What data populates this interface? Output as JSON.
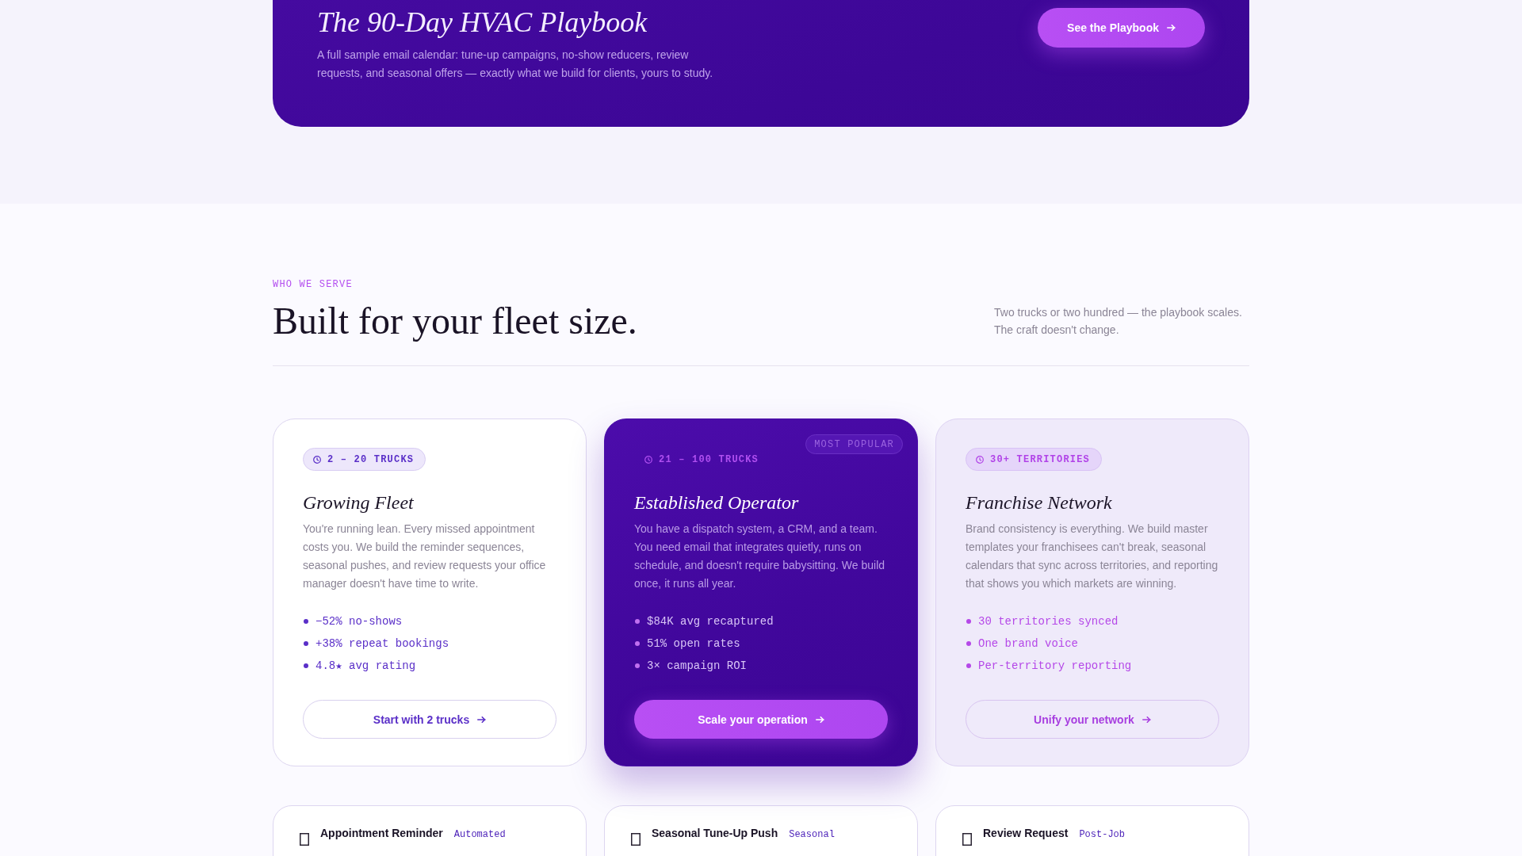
{
  "promo_banner": {
    "title": "The 90-Day HVAC Playbook",
    "description": "A full sample email calendar: tune-up campaigns, no-show reducers, review requests, and seasonal offers — exactly what we build for clients, yours to study.",
    "button": "See the Playbook"
  },
  "section": {
    "eyebrow": "WHO WE SERVE",
    "heading": "Built for your fleet size.",
    "aside": "Two trucks or two hundred — the playbook scales. The craft doesn't change."
  },
  "plans": [
    {
      "kind": "plain",
      "badge": "2 – 20 TRUCKS",
      "title": "Growing Fleet",
      "description": "You're running lean. Every missed appointment costs you. We build the reminder sequences, seasonal pushes, and review requests your office manager doesn't have time to write.",
      "highlights": [
        "−52% no-shows",
        "+38% repeat bookings",
        "4.8★ avg rating"
      ],
      "button": "Start with 2 trucks"
    },
    {
      "kind": "featured",
      "ribbon": "MOST POPULAR",
      "badge": "21 – 100 TRUCKS",
      "title": "Established Operator",
      "description": "You have a dispatch system, a CRM, and a team. You need email that integrates quietly, runs on schedule, and doesn't require babysitting. We build once, it runs all year.",
      "highlights": [
        "$84K avg recaptured",
        "51% open rates",
        "3× campaign ROI"
      ],
      "button": "Scale your operation"
    },
    {
      "kind": "tinted",
      "badge": "30+ TERRITORIES",
      "title": "Franchise Network",
      "description": "Brand consistency is everything. We build master templates your franchisees can't break, seasonal calendars that sync across territories, and reporting that shows you which markets are winning.",
      "highlights": [
        "30 territories synced",
        "One brand voice",
        "Per-territory reporting"
      ],
      "button": "Unify your network"
    }
  ],
  "templates": [
    {
      "title": "Appointment Reminder",
      "tag": "Automated"
    },
    {
      "title": "Seasonal Tune-Up Push",
      "tag": "Seasonal"
    },
    {
      "title": "Review Request",
      "tag": "Post-Job"
    }
  ]
}
